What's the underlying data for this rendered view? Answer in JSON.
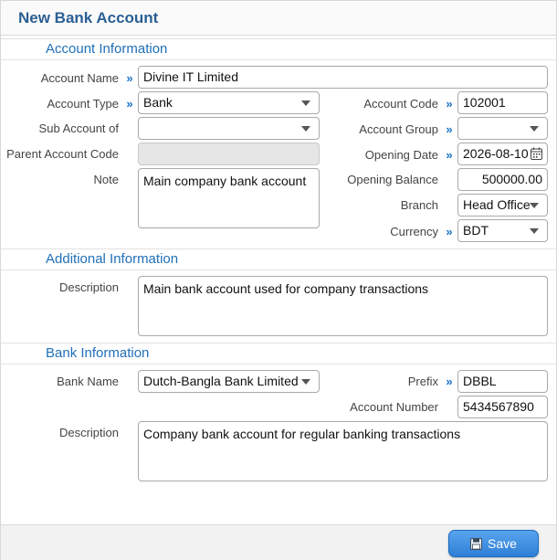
{
  "dialog": {
    "title": "New Bank Account"
  },
  "sections": {
    "account": "Account Information",
    "additional": "Additional Information",
    "bank": "Bank Information"
  },
  "account": {
    "account_name_label": "Account Name",
    "account_name": "Divine IT Limited",
    "account_type_label": "Account Type",
    "account_type": "Bank",
    "sub_account_label": "Sub Account of",
    "sub_account": "",
    "parent_code_label": "Parent Account Code",
    "parent_code": "",
    "note_label": "Note",
    "note": "Main company bank account",
    "account_code_label": "Account Code",
    "account_code": "102001",
    "account_group_label": "Account Group",
    "account_group": "",
    "opening_date_label": "Opening Date",
    "opening_date": "2026-08-10",
    "opening_balance_label": "Opening Balance",
    "opening_balance": "500000.00",
    "branch_label": "Branch",
    "branch": "Head Office",
    "currency_label": "Currency",
    "currency": "BDT"
  },
  "additional": {
    "description_label": "Description",
    "description": "Main bank account used for company transactions"
  },
  "bank": {
    "bank_name_label": "Bank Name",
    "bank_name": "Dutch-Bangla Bank Limited",
    "prefix_label": "Prefix",
    "prefix": "DBBL",
    "account_number_label": "Account Number",
    "account_number": "5434567890",
    "description_label": "Description",
    "description": "Company bank account for regular banking transactions"
  },
  "footer": {
    "save_label": "Save"
  },
  "colors": {
    "accent": "#1f6fb8",
    "title": "#2b5f94",
    "button": "#2f7fd6"
  },
  "icons": {
    "required": "double-chevron-right-icon",
    "date": "calendar-icon",
    "save": "floppy-disk-icon"
  }
}
